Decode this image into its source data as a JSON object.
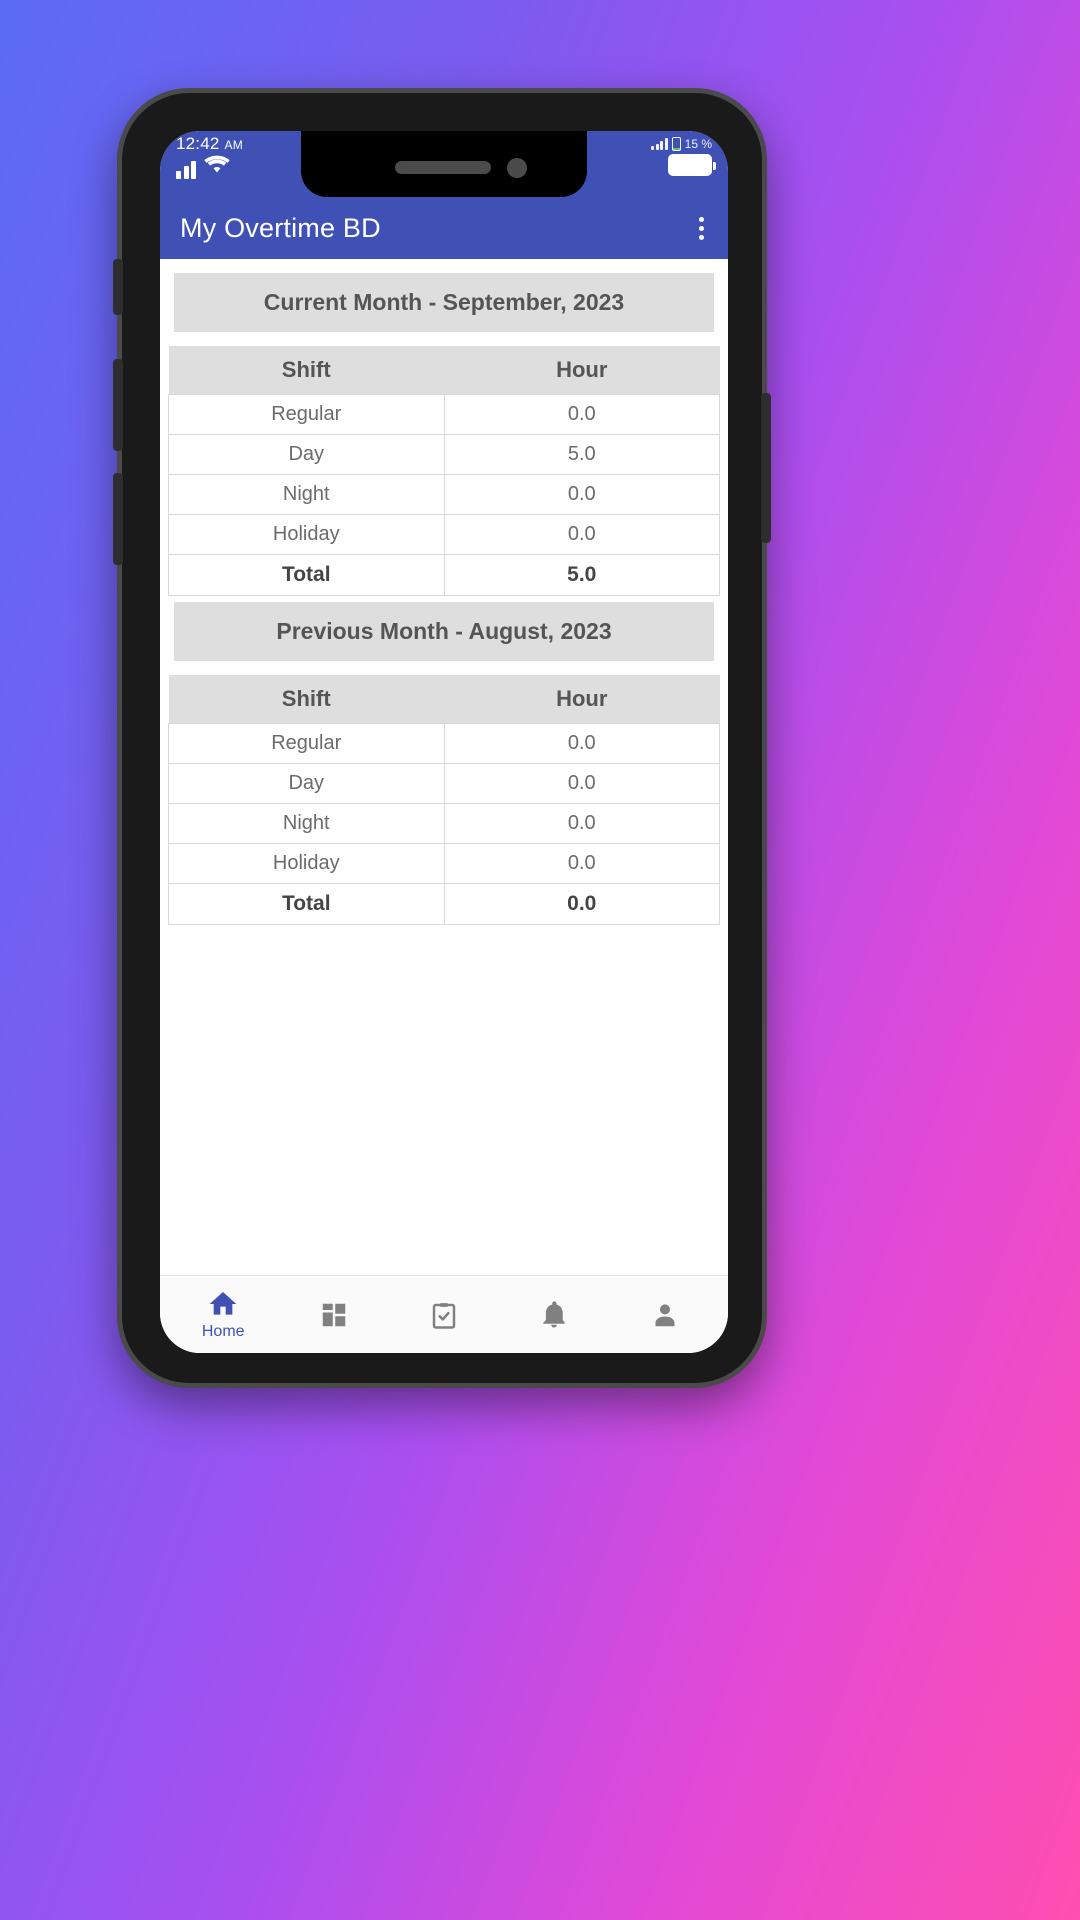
{
  "status_bar": {
    "time": "12:42",
    "ampm": "AM",
    "battery_percent": "15 %",
    "signal_icon": "signal-bars-icon",
    "wifi_icon": "wifi-icon",
    "battery_icon": "battery-icon"
  },
  "app_bar": {
    "title": "My Overtime BD",
    "overflow_icon": "overflow-menu-icon"
  },
  "colors": {
    "primary": "#3f51b5",
    "header_bg": "#dedede",
    "text_gray": "#6b6b6b"
  },
  "sections": [
    {
      "header": "Current Month - September, 2023",
      "columns": [
        "Shift",
        "Hour"
      ],
      "rows": [
        {
          "shift": "Regular",
          "hour": "0.0",
          "is_total": false
        },
        {
          "shift": "Day",
          "hour": "5.0",
          "is_total": false
        },
        {
          "shift": "Night",
          "hour": "0.0",
          "is_total": false
        },
        {
          "shift": "Holiday",
          "hour": "0.0",
          "is_total": false
        },
        {
          "shift": "Total",
          "hour": "5.0",
          "is_total": true
        }
      ]
    },
    {
      "header": "Previous Month - August, 2023",
      "columns": [
        "Shift",
        "Hour"
      ],
      "rows": [
        {
          "shift": "Regular",
          "hour": "0.0",
          "is_total": false
        },
        {
          "shift": "Day",
          "hour": "0.0",
          "is_total": false
        },
        {
          "shift": "Night",
          "hour": "0.0",
          "is_total": false
        },
        {
          "shift": "Holiday",
          "hour": "0.0",
          "is_total": false
        },
        {
          "shift": "Total",
          "hour": "0.0",
          "is_total": true
        }
      ]
    }
  ],
  "bottom_nav": [
    {
      "icon": "home-icon",
      "label": "Home",
      "active": true
    },
    {
      "icon": "dashboard-grid-icon",
      "label": "",
      "active": false
    },
    {
      "icon": "clipboard-check-icon",
      "label": "",
      "active": false
    },
    {
      "icon": "bell-icon",
      "label": "",
      "active": false
    },
    {
      "icon": "person-icon",
      "label": "",
      "active": false
    }
  ]
}
